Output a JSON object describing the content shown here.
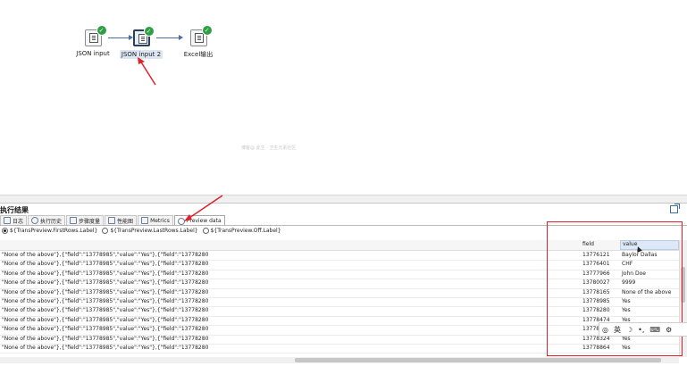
{
  "canvas": {
    "steps": [
      {
        "label": "JSON input"
      },
      {
        "label": "JSON input 2"
      },
      {
        "label": "Excel输出"
      }
    ],
    "watermark": "博客@ 此生 · 卫生元素社区"
  },
  "results": {
    "title": "执行结果",
    "tabs": [
      {
        "label": "日志"
      },
      {
        "label": "执行历史"
      },
      {
        "label": "步骤度量"
      },
      {
        "label": "性能图"
      },
      {
        "label": "Metrics"
      },
      {
        "label": "Preview data"
      }
    ],
    "radios": [
      {
        "label": "${TransPreview.FirstRows.Label}"
      },
      {
        "label": "${TransPreview.LastRows.Label}"
      },
      {
        "label": "${TransPreview.Off.Label}"
      }
    ],
    "columns": {
      "field": "field",
      "value": "value"
    },
    "rows": [
      {
        "json": "\"None of the above\"},{\"field\":\"13778985\",\"value\":\"Yes\"},{\"field\":\"13778280",
        "field": "13776121",
        "value": "Baylor Dallas"
      },
      {
        "json": "\"None of the above\"},{\"field\":\"13778985\",\"value\":\"Yes\"},{\"field\":\"13778280",
        "field": "13776401",
        "value": "CHF"
      },
      {
        "json": "\"None of the above\"},{\"field\":\"13778985\",\"value\":\"Yes\"},{\"field\":\"13778280",
        "field": "13777966",
        "value": "John Doe"
      },
      {
        "json": "\"None of the above\"},{\"field\":\"13778985\",\"value\":\"Yes\"},{\"field\":\"13778280",
        "field": "13780027",
        "value": "9999"
      },
      {
        "json": "\"None of the above\"},{\"field\":\"13778985\",\"value\":\"Yes\"},{\"field\":\"13778280",
        "field": "13778165",
        "value": "None of the above"
      },
      {
        "json": "\"None of the above\"},{\"field\":\"13778985\",\"value\":\"Yes\"},{\"field\":\"13778280",
        "field": "13778985",
        "value": "Yes"
      },
      {
        "json": "\"None of the above\"},{\"field\":\"13778985\",\"value\":\"Yes\"},{\"field\":\"13778280",
        "field": "13778280",
        "value": "Yes"
      },
      {
        "json": "\"None of the above\"},{\"field\":\"13778985\",\"value\":\"Yes\"},{\"field\":\"13778280",
        "field": "13778474",
        "value": "Yes"
      },
      {
        "json": "\"None of the above\"},{\"field\":\"13778985\",\"value\":\"Yes\"},{\"field\":\"13778280",
        "field": "137782",
        "value": ""
      },
      {
        "json": "\"None of the above\"},{\"field\":\"13778985\",\"value\":\"Yes\"},{\"field\":\"13778280",
        "field": "13778324",
        "value": "Yes"
      },
      {
        "json": "\"None of the above\"},{\"field\":\"13778985\",\"value\":\"Yes\"},{\"field\":\"13778280",
        "field": "13778864",
        "value": "Yes"
      }
    ]
  },
  "ime": {
    "label": "英"
  },
  "colors": {
    "highlight": "#e0212a",
    "ok": "#2ea043",
    "hop": "#4a6ea0"
  }
}
